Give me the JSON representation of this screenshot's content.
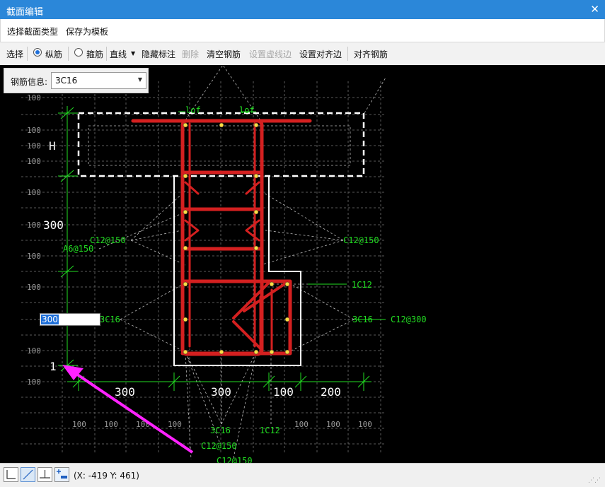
{
  "window": {
    "title": "截面编辑",
    "close_glyph": "✕"
  },
  "menu": {
    "items": [
      "选择截面类型",
      "保存为模板"
    ]
  },
  "toolbar": {
    "select": "选择",
    "longitudinal": "纵筋",
    "stirrup": "箍筋",
    "line": "直线",
    "hide_dims": "隐藏标注",
    "delete": "删除",
    "clear_rebar": "清空钢筋",
    "set_dashed": "设置虚线边",
    "set_align_edge": "设置对齐边",
    "align_rebar": "对齐钢筋",
    "radio_selected": "longitudinal"
  },
  "rebar_info": {
    "label": "钢筋信息:",
    "value": "3C16"
  },
  "edit_input": {
    "value": "300"
  },
  "drawing": {
    "grid_label": "100",
    "vertical_dims": [
      "H",
      "300",
      "1"
    ],
    "horizontal_dims": [
      "300",
      "300",
      "100",
      "200"
    ],
    "lof_labels": [
      "lof",
      "lof"
    ],
    "annotations": {
      "left_stirrup": "C12@150",
      "left_tie": "A6@150",
      "left_long": "3C16",
      "right_stirrup": "C12@150",
      "right_single": "1C12",
      "right_long": "3C16",
      "right_tie": "C12@300",
      "bottom_long": "3C16",
      "bottom_single": "1C12",
      "bottom_stirrup1": "C12@150",
      "bottom_stirrup2": "C12@150"
    },
    "colors": {
      "rebar": "#d42020",
      "dim": "#22dd22",
      "outline": "#ffffff",
      "grid": "#888888",
      "arrow": "#ff22ff"
    }
  },
  "status": {
    "coords": "(X: -419 Y: 461)",
    "modes": [
      "orthogonal-snap",
      "diagonal-snap",
      "perpendicular-snap",
      "add-dimension"
    ]
  }
}
